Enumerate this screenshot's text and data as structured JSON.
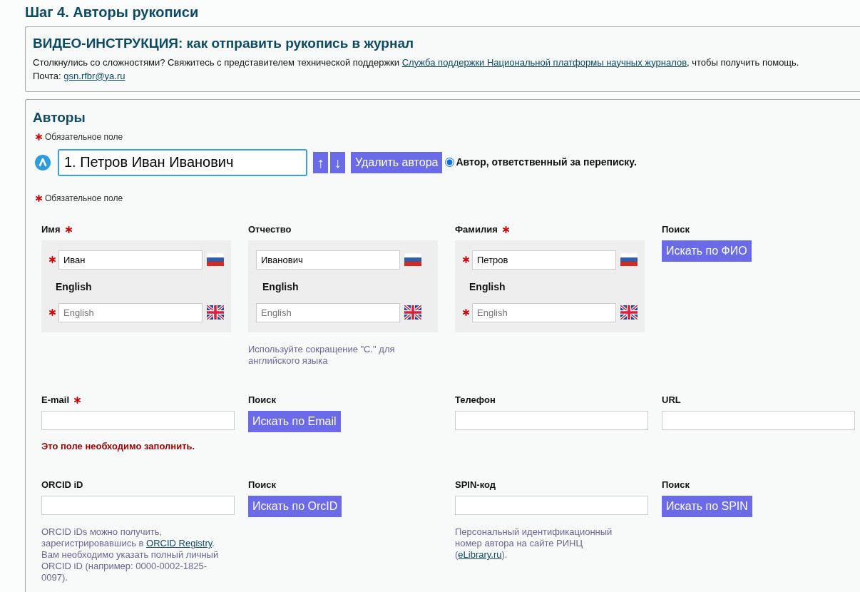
{
  "page_title": "Шаг 4. Авторы рукописи",
  "info": {
    "title": "ВИДЕО-ИНСТРУКЦИЯ: как отправить рукопись в журнал",
    "support_parts": [
      {
        "text": "Столкнулись со сложностями? Свяжитесь с представителем технической поддержки "
      },
      {
        "link": "Служба поддержки Национальной платформы научных журналов"
      },
      {
        "text": ", чтобы получить помощь."
      }
    ],
    "mail_parts": [
      {
        "text": "Почта: "
      },
      {
        "link": "gsn.rfbr@ya.ru"
      }
    ]
  },
  "authors": {
    "title": "Авторы",
    "required_note": "Обязательное поле",
    "author_bar": {
      "value": "1. Петров Иван Иванович",
      "up": "↑",
      "down": "↓",
      "delete": "Удалить автора",
      "corresponding": {
        "label": "Автор, ответственный за переписку.",
        "selected": true
      }
    },
    "required_note_2": "Обязательное поле",
    "name_fields": [
      {
        "label": "Имя",
        "required": true,
        "ru_required": true,
        "ru_value": "Иван",
        "en_label": "English",
        "en_required": true,
        "en_placeholder": "English"
      },
      {
        "label": "Отчество",
        "required": false,
        "ru_required": false,
        "ru_value": "Иванович",
        "en_label": "English",
        "en_required": false,
        "en_placeholder": "English",
        "hint": "Используйте сокращение \"С.\" для английского языка"
      },
      {
        "label": "Фамилия",
        "required": true,
        "ru_required": true,
        "ru_value": "Петров",
        "en_label": "English",
        "en_required": true,
        "en_placeholder": "English"
      }
    ],
    "name_search": {
      "label": "Поиск",
      "button": "Искать по ФИО"
    },
    "rows": [
      [
        {
          "kind": "input",
          "label": "E-mail",
          "required": true,
          "error": "Это поле необходимо заполнить."
        },
        {
          "kind": "search",
          "label": "Поиск",
          "button": "Искать по Email"
        },
        {
          "kind": "input",
          "label": "Телефон",
          "required": false
        },
        {
          "kind": "input",
          "label": "URL",
          "required": false
        }
      ],
      [
        {
          "kind": "input",
          "label": "ORCID iD",
          "required": false,
          "hint_parts": [
            {
              "text": "ORCID iDs можно получить, зарегистрировавшись в "
            },
            {
              "link": "ORCID Registry"
            },
            {
              "text": ". Вам необходимо указать полный личный ORCID iD (например: 0000-0002-1825-0097)."
            }
          ]
        },
        {
          "kind": "search",
          "label": "Поиск",
          "button": "Искать по OrcID"
        },
        {
          "kind": "input",
          "label": "SPIN-код",
          "required": false,
          "hint_parts": [
            {
              "text": "Персональный идентификационный номер автора на сайте РИНЦ ("
            },
            {
              "link": "eLibrary.ru"
            },
            {
              "text": ")."
            }
          ]
        },
        {
          "kind": "search",
          "label": "Поиск",
          "button": "Искать по SPIN"
        }
      ]
    ]
  }
}
